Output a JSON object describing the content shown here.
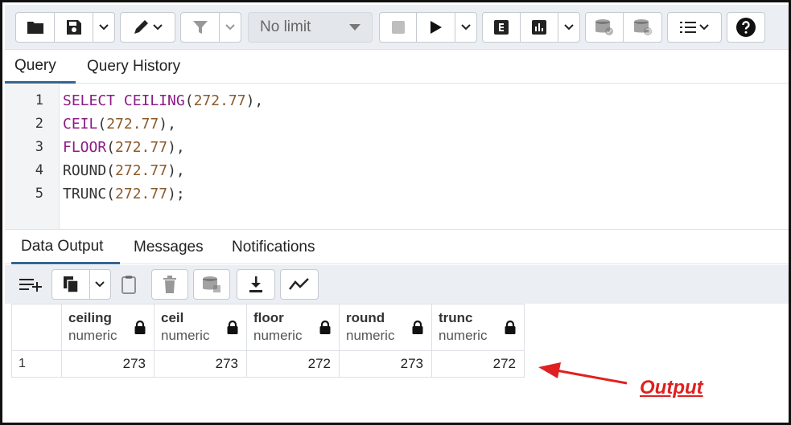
{
  "toolbar": {
    "limit_select": "No limit",
    "icons": [
      "folder-icon",
      "save-icon",
      "edit-icon",
      "filter-icon",
      "stop-icon",
      "play-icon",
      "explain-icon",
      "explain-analyze-icon",
      "commit-icon",
      "rollback-icon",
      "macros-icon",
      "help-icon"
    ]
  },
  "query_tabs": {
    "query": "Query",
    "history": "Query History"
  },
  "editor": {
    "lines": [
      {
        "num": "1",
        "parts": [
          {
            "t": "SELECT CEILING",
            "c": "kw"
          },
          {
            "t": "(",
            "c": ""
          },
          {
            "t": "272.77",
            "c": "num"
          },
          {
            "t": "),",
            "c": ""
          }
        ]
      },
      {
        "num": "2",
        "parts": [
          {
            "t": "CEIL",
            "c": "kw"
          },
          {
            "t": "(",
            "c": ""
          },
          {
            "t": "272.77",
            "c": "num"
          },
          {
            "t": "),",
            "c": ""
          }
        ]
      },
      {
        "num": "3",
        "parts": [
          {
            "t": "FLOOR",
            "c": "kw"
          },
          {
            "t": "(",
            "c": ""
          },
          {
            "t": "272.77",
            "c": "num"
          },
          {
            "t": "),",
            "c": ""
          }
        ]
      },
      {
        "num": "4",
        "parts": [
          {
            "t": "ROUND(",
            "c": ""
          },
          {
            "t": "272.77",
            "c": "num"
          },
          {
            "t": "),",
            "c": ""
          }
        ]
      },
      {
        "num": "5",
        "parts": [
          {
            "t": "TRUNC(",
            "c": ""
          },
          {
            "t": "272.77",
            "c": "num"
          },
          {
            "t": ");",
            "c": ""
          }
        ]
      }
    ]
  },
  "output_tabs": {
    "data_output": "Data Output",
    "messages": "Messages",
    "notifications": "Notifications"
  },
  "grid": {
    "columns": [
      {
        "name": "ceiling",
        "type": "numeric"
      },
      {
        "name": "ceil",
        "type": "numeric"
      },
      {
        "name": "floor",
        "type": "numeric"
      },
      {
        "name": "round",
        "type": "numeric"
      },
      {
        "name": "trunc",
        "type": "numeric"
      }
    ],
    "rows": [
      {
        "num": "1",
        "values": [
          "273",
          "273",
          "272",
          "273",
          "272"
        ]
      }
    ]
  },
  "annotation": {
    "label": "Output",
    "color": "#e02020"
  },
  "colors": {
    "accent": "#326690",
    "keyword": "#8b1b86",
    "number": "#8a5a2b"
  }
}
